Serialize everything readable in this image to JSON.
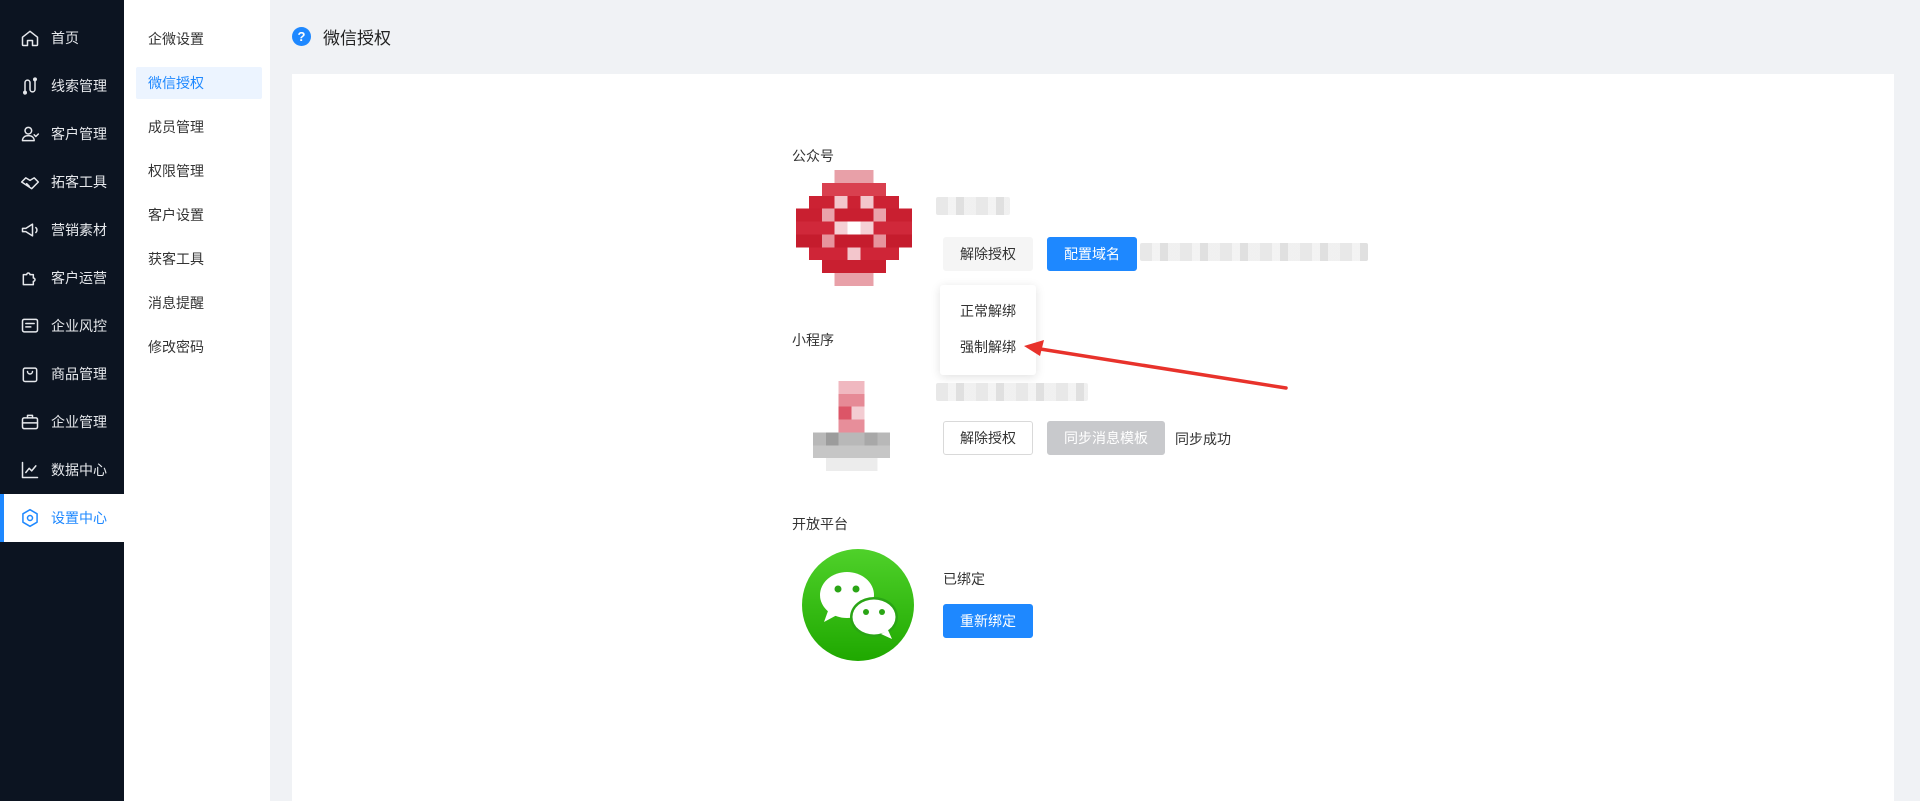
{
  "nav": {
    "items": [
      {
        "label": "首页",
        "icon": "home-icon"
      },
      {
        "label": "线索管理",
        "icon": "route-icon"
      },
      {
        "label": "客户管理",
        "icon": "users-icon"
      },
      {
        "label": "拓客工具",
        "icon": "handshake-icon"
      },
      {
        "label": "营销素材",
        "icon": "megaphone-icon"
      },
      {
        "label": "客户运营",
        "icon": "puzzle-icon"
      },
      {
        "label": "企业风控",
        "icon": "message-square-icon"
      },
      {
        "label": "商品管理",
        "icon": "shopping-bag-icon"
      },
      {
        "label": "企业管理",
        "icon": "briefcase-icon"
      },
      {
        "label": "数据中心",
        "icon": "chart-line-icon"
      },
      {
        "label": "设置中心",
        "icon": "settings-icon"
      }
    ],
    "active_index": 10
  },
  "submenu": {
    "items": [
      "企微设置",
      "微信授权",
      "成员管理",
      "权限管理",
      "客户设置",
      "获客工具",
      "消息提醒",
      "修改密码"
    ],
    "active_index": 1
  },
  "page": {
    "title": "微信授权",
    "help_icon": "?"
  },
  "official_account": {
    "label": "公众号",
    "unbind_button": "解除授权",
    "config_domain_button": "配置域名",
    "dropdown": {
      "normal_unbind": "正常解绑",
      "force_unbind": "强制解绑"
    }
  },
  "mini_program": {
    "label": "小程序",
    "unbind_button": "解除授权",
    "sync_button": "同步消息模板",
    "sync_status": "同步成功"
  },
  "open_platform": {
    "label": "开放平台",
    "status": "已绑定",
    "rebind_button": "重新绑定"
  },
  "colors": {
    "accent": "#1e88ff",
    "nav_bg": "#0c1421",
    "arrow": "#e8322b",
    "wechat_green": "#2dc100"
  }
}
